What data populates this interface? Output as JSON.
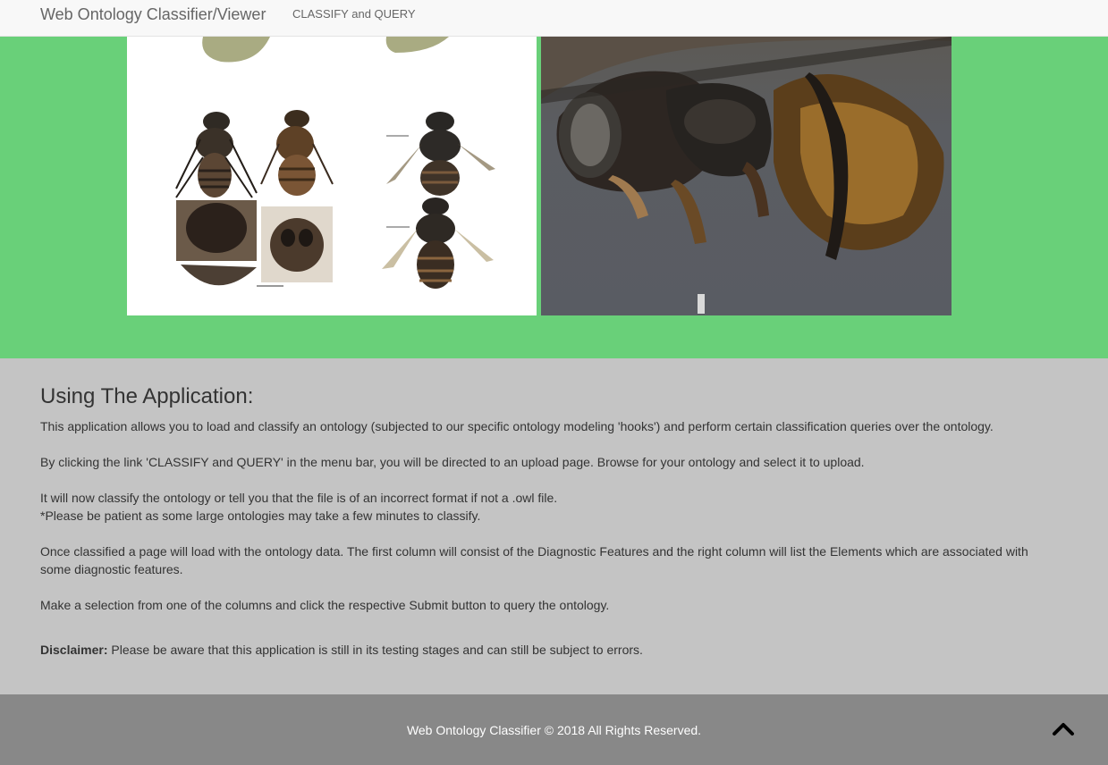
{
  "navbar": {
    "brand": "Web Ontology Classifier/Viewer",
    "links": [
      "CLASSIFY and QUERY"
    ]
  },
  "hero": {
    "background_color": "#69d079",
    "images": [
      {
        "name": "bee-specimen-plate"
      },
      {
        "name": "bee-closeup-photo"
      }
    ]
  },
  "about": {
    "title": "Using The Application:",
    "paragraphs": [
      "This application allows you to load and classify an ontology (subjected to our specific ontology modeling 'hooks') and perform certain classification queries over the ontology.",
      "By clicking the link 'CLASSIFY and QUERY' in the menu bar, you will be directed to an upload page. Browse for your ontology and select it to upload.",
      "It will now classify the ontology or tell you that the file is of an incorrect format if not a .owl file.",
      "*Please be patient as some large ontologies may take a few minutes to classify.",
      "Once classified a page will load with the ontology data. The first column will consist of the Diagnostic Features and the right column will list the Elements which are associated with some diagnostic features.",
      "Make a selection from one of the columns and click the respective Submit button to query the ontology."
    ],
    "disclaimer_label": "Disclaimer:",
    "disclaimer_text": " Please be aware that this application is still in its testing stages and can still be subject to errors."
  },
  "footer": {
    "text": "Web Ontology Classifier © 2018 All Rights Reserved.",
    "scroll_icon": "chevron-up-icon"
  }
}
